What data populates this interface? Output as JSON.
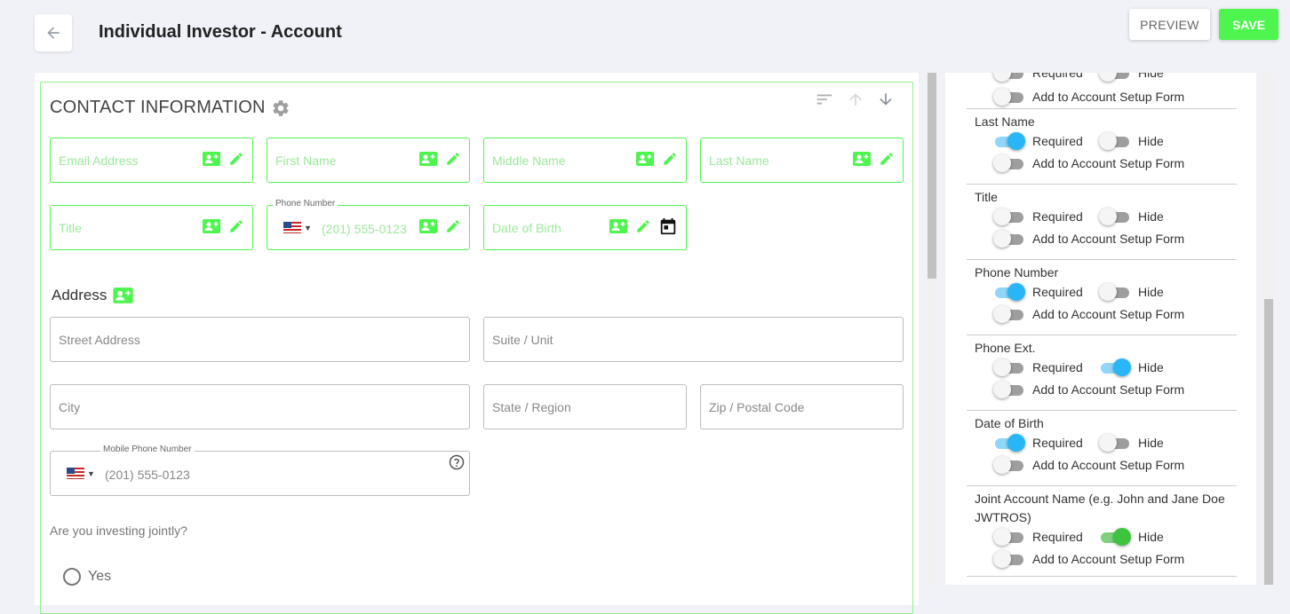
{
  "header": {
    "title": "Individual Investor - Account",
    "preview_label": "PREVIEW",
    "save_label": "SAVE"
  },
  "colors": {
    "accent_green": "#4ef54e",
    "toggle_blue": "#29b6f6",
    "highlight": "#eef85a"
  },
  "section": {
    "title": "CONTACT INFORMATION",
    "fields": {
      "email": "Email Address",
      "first_name": "First Name",
      "middle_name": "Middle Name",
      "last_name": "Last Name",
      "title": "Title",
      "phone_label": "Phone Number",
      "phone_placeholder": "(201) 555-0123",
      "dob": "Date of Birth"
    },
    "address_label": "Address",
    "address": {
      "street": "Street Address",
      "suite": "Suite / Unit",
      "city": "City",
      "state": "State / Region",
      "zip": "Zip / Postal Code"
    },
    "mobile": {
      "label": "Mobile Phone Number",
      "placeholder": "(201) 555-0123"
    },
    "question": "Are you investing jointly?",
    "radio_yes": "Yes"
  },
  "properties": {
    "labels": {
      "required": "Required",
      "hide": "Hide",
      "add_setup": "Add to Account Setup Form"
    },
    "items": [
      {
        "name": "",
        "required": false,
        "hide": false,
        "add": false
      },
      {
        "name": "Last Name",
        "required": true,
        "hide": false,
        "add": false
      },
      {
        "name": "Title",
        "required": false,
        "hide": false,
        "add": false
      },
      {
        "name": "Phone Number",
        "required": true,
        "hide": false,
        "add": false
      },
      {
        "name": "Phone Ext.",
        "required": false,
        "hide": true,
        "add": false
      },
      {
        "name": "Date of Birth",
        "required": true,
        "hide": false,
        "add": false
      },
      {
        "name": "Joint Account Name (e.g. John and Jane Doe",
        "name_line2": "JWTROS)",
        "required": false,
        "hide": true,
        "add": false
      }
    ]
  }
}
